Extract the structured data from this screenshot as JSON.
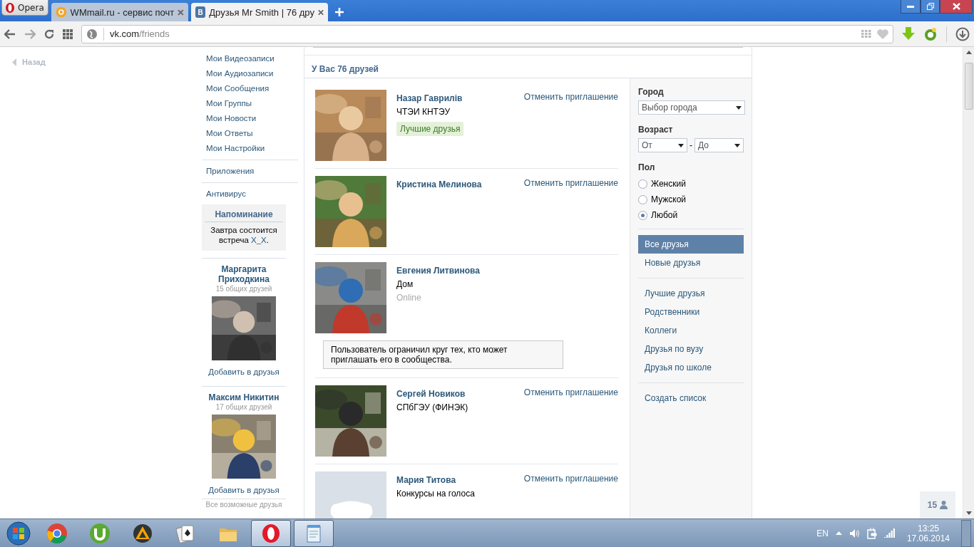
{
  "browser": {
    "opera_button": "Opera",
    "tabs": [
      {
        "title": "WMmail.ru - сервис почт",
        "selected": false
      },
      {
        "title": "Друзья Mr Smith | 76 дру",
        "selected": true,
        "favicon_text": "В"
      }
    ],
    "address": {
      "host": "vk.com",
      "path": "/friends"
    }
  },
  "page": {
    "back": "Назад",
    "menu_sections": [
      [
        "Мои Видеозаписи",
        "Мои Аудиозаписи",
        "Мои Сообщения",
        "Мои Группы",
        "Мои Новости",
        "Мои Ответы",
        "Мои Настройки"
      ],
      [
        "Приложения"
      ],
      [
        "Антивирус"
      ]
    ],
    "reminder": {
      "title": "Напоминание",
      "text_before": "Завтра состоится встреча ",
      "link": "X_X",
      "text_after": "."
    },
    "suggestions": [
      {
        "name": "Маргарита Приходкина",
        "mutual": "15 общих друзей",
        "action": "Добавить в друзья"
      },
      {
        "name": "Максим Никитин",
        "mutual": "17 общих друзей",
        "action": "Добавить в друзья"
      }
    ],
    "all_possible": "Все возможные друзья",
    "friends_heading": "У Вас 76 друзей",
    "friends": [
      {
        "name": "Назар Гаврилів",
        "kind": "picture",
        "lines": [
          "ЧТЭИ КНТЭУ"
        ],
        "tag": "Лучшие друзья",
        "action": "Отменить приглашение"
      },
      {
        "name": "Кристина Мелинова",
        "kind": "picture",
        "action": "Отменить приглашение"
      },
      {
        "name": "Евгения Литвинова",
        "kind": "picture",
        "lines": [
          "Дом"
        ],
        "status": "Online",
        "notice": "Пользователь ограничил круг тех, кто может приглашать его в сообщества."
      },
      {
        "name": "Сергей Новиков",
        "kind": "picture",
        "lines": [
          "СПбГЭУ (ФИНЭК)"
        ],
        "action": "Отменить приглашение"
      },
      {
        "name": "Мария Титова",
        "kind": "default",
        "lines": [
          "Конкурсы на голоса"
        ],
        "action": "Отменить приглашение"
      }
    ],
    "filters": {
      "city": {
        "label": "Город",
        "value": "Выбор города"
      },
      "age": {
        "label": "Возраст",
        "from": "От",
        "separator": "-",
        "to": "До"
      },
      "gender": {
        "label": "Пол",
        "options": [
          {
            "label": "Женский",
            "selected": false
          },
          {
            "label": "Мужской",
            "selected": false
          },
          {
            "label": "Любой",
            "selected": true
          }
        ]
      },
      "lists": [
        [
          {
            "label": "Все друзья",
            "selected": true
          },
          {
            "label": "Новые друзья",
            "selected": false
          }
        ],
        [
          {
            "label": "Лучшие друзья",
            "selected": false
          },
          {
            "label": "Родственники",
            "selected": false
          },
          {
            "label": "Коллеги",
            "selected": false
          },
          {
            "label": "Друзья по вузу",
            "selected": false
          },
          {
            "label": "Друзья по школе",
            "selected": false
          }
        ]
      ],
      "create_list": "Создать список"
    },
    "online_badge": {
      "count": "15"
    }
  },
  "taskbar": {
    "apps": [
      {
        "kind": "chrome",
        "running": false
      },
      {
        "kind": "torrent",
        "running": false
      },
      {
        "kind": "player",
        "running": false
      },
      {
        "kind": "cards",
        "running": false
      },
      {
        "kind": "folder",
        "running": false
      },
      {
        "kind": "opera",
        "running": true
      },
      {
        "kind": "notepad",
        "running": true
      }
    ],
    "tray": {
      "language": "EN",
      "time": "13:25",
      "date": "17.06.2014"
    }
  }
}
